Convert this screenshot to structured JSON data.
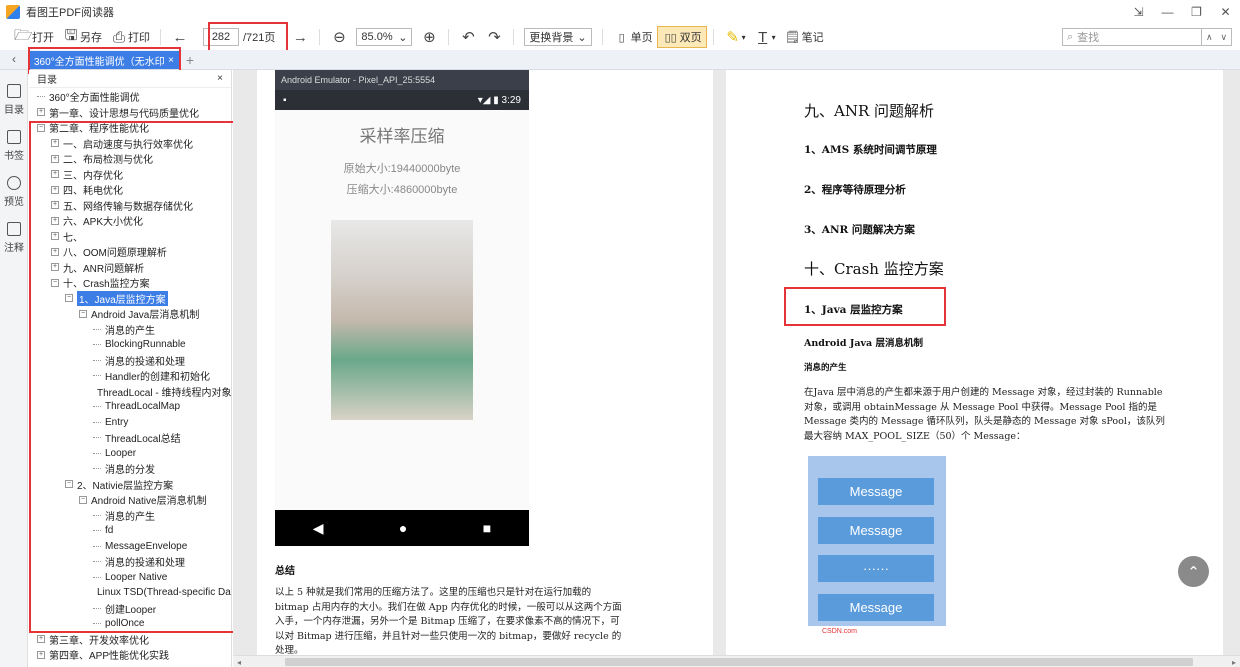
{
  "app": {
    "title": "看图王PDF阅读器"
  },
  "window": {
    "minimize": "—",
    "restore": "❐",
    "maximize": "□",
    "close": "✕",
    "extra": "⇲"
  },
  "toolbar": {
    "open": "打开",
    "save_as": "另存",
    "print": "打印",
    "current_page": "282",
    "total_pages": "/721页",
    "zoom": "85.0%",
    "background": "更换背景",
    "single_page": "单页",
    "double_page": "双页",
    "notes": "笔记",
    "search_placeholder": "查找"
  },
  "tabs": {
    "document_tab": "360°全方面性能调优（无水印）",
    "close": "×",
    "add": "+"
  },
  "rail": {
    "items": [
      "目录",
      "书签",
      "预览",
      "注释"
    ]
  },
  "outline": {
    "title": "目录",
    "close": "×",
    "rows": [
      {
        "text": "360°全方面性能调优",
        "level": 0,
        "kind": "leaf"
      },
      {
        "text": "第一章、设计思想与代码质量优化",
        "level": 0,
        "kind": "plus"
      },
      {
        "text": "第二章、程序性能优化",
        "level": 0,
        "kind": "minus"
      },
      {
        "text": "一、启动速度与执行效率优化",
        "level": 1,
        "kind": "plus"
      },
      {
        "text": "二、布局检测与优化",
        "level": 1,
        "kind": "plus"
      },
      {
        "text": "三、内存优化",
        "level": 1,
        "kind": "plus"
      },
      {
        "text": "四、耗电优化",
        "level": 1,
        "kind": "plus"
      },
      {
        "text": "五、网络传输与数据存储优化",
        "level": 1,
        "kind": "plus"
      },
      {
        "text": "六、APK大小优化",
        "level": 1,
        "kind": "plus"
      },
      {
        "text": "七、",
        "level": 1,
        "kind": "plus"
      },
      {
        "text": "八、OOM问题原理解析",
        "level": 1,
        "kind": "plus"
      },
      {
        "text": "九、ANR问题解析",
        "level": 1,
        "kind": "plus"
      },
      {
        "text": "十、Crash监控方案",
        "level": 1,
        "kind": "minus"
      },
      {
        "text": "1、Java层监控方案",
        "level": 2,
        "kind": "minus",
        "selected": true
      },
      {
        "text": "Android Java层消息机制",
        "level": 3,
        "kind": "minus"
      },
      {
        "text": "消息的产生",
        "level": 4,
        "kind": "leaf"
      },
      {
        "text": "BlockingRunnable",
        "level": 4,
        "kind": "leaf"
      },
      {
        "text": "消息的投递和处理",
        "level": 4,
        "kind": "leaf"
      },
      {
        "text": "Handler的创建和初始化",
        "level": 4,
        "kind": "leaf"
      },
      {
        "text": "ThreadLocal - 维持线程内对象",
        "level": 4,
        "kind": "leaf"
      },
      {
        "text": "ThreadLocalMap",
        "level": 4,
        "kind": "leaf"
      },
      {
        "text": "Entry",
        "level": 4,
        "kind": "leaf"
      },
      {
        "text": "ThreadLocal总结",
        "level": 4,
        "kind": "leaf"
      },
      {
        "text": "Looper",
        "level": 4,
        "kind": "leaf"
      },
      {
        "text": "消息的分发",
        "level": 4,
        "kind": "leaf"
      },
      {
        "text": "2、Nativie层监控方案",
        "level": 2,
        "kind": "minus"
      },
      {
        "text": "Android Native层消息机制",
        "level": 3,
        "kind": "minus"
      },
      {
        "text": "消息的产生",
        "level": 4,
        "kind": "leaf"
      },
      {
        "text": "fd",
        "level": 4,
        "kind": "leaf"
      },
      {
        "text": "MessageEnvelope",
        "level": 4,
        "kind": "leaf"
      },
      {
        "text": "消息的投递和处理",
        "level": 4,
        "kind": "leaf"
      },
      {
        "text": "Looper Native",
        "level": 4,
        "kind": "leaf"
      },
      {
        "text": "Linux TSD(Thread-specific Data",
        "level": 4,
        "kind": "leaf"
      },
      {
        "text": "创建Looper",
        "level": 4,
        "kind": "leaf"
      },
      {
        "text": "pollOnce",
        "level": 4,
        "kind": "leaf"
      },
      {
        "text": "第三章、开发效率优化",
        "level": 0,
        "kind": "plus"
      },
      {
        "text": "第四章、APP性能优化实践",
        "level": 0,
        "kind": "plus"
      }
    ]
  },
  "left_page": {
    "emulator_title": "Android Emulator - Pixel_API_25:5554",
    "status_time": "3:29",
    "heading": "采样率压缩",
    "original_size": "原始大小:19440000byte",
    "compressed_size": "压缩大小:4860000byte",
    "summary_title": "总结",
    "summary_text": "以上 5 种就是我们常用的压缩方法了。这里的压缩也只是针对在运行加载的 bitmap 占用内存的大小。我们在做 App 内存优化的时候，一般可以从这两个方面入手，一个内存泄漏，另外一个是 Bitmap 压缩了，在要求像素不高的情况下，可以对 Bitmap 进行压缩，并且针对一些只使用一次的 bitmap，要做好 recycle 的处理。"
  },
  "right_page": {
    "h_anr": "九、ANR 问题解析",
    "anr_1": "1、AMS 系统时间调节原理",
    "anr_2": "2、程序等待原理分析",
    "anr_3": "3、ANR 问题解决方案",
    "h_crash": "十、Crash 监控方案",
    "crash_1": "1、Java 层监控方案",
    "sub_title": "Android Java 层消息机制",
    "sub_sub": "消息的产生",
    "paragraph": "在Java 层中消息的产生都来源于用户创建的 Message 对象，经过封装的 Runnable 对象，或调用 obtainMessage 从 Message Pool 中获得。Message Pool 指的是 Message 类内的 Message 循环队列，队头是静态的 Message 对象 sPool，该队列最大容纳 MAX_POOL_SIZE（50）个 Message：",
    "diagram": [
      "Message",
      "Message",
      "······",
      "Message"
    ],
    "watermark": "CSDN.com"
  },
  "accent": "#3d7ee6",
  "highlight": "#e5333a"
}
